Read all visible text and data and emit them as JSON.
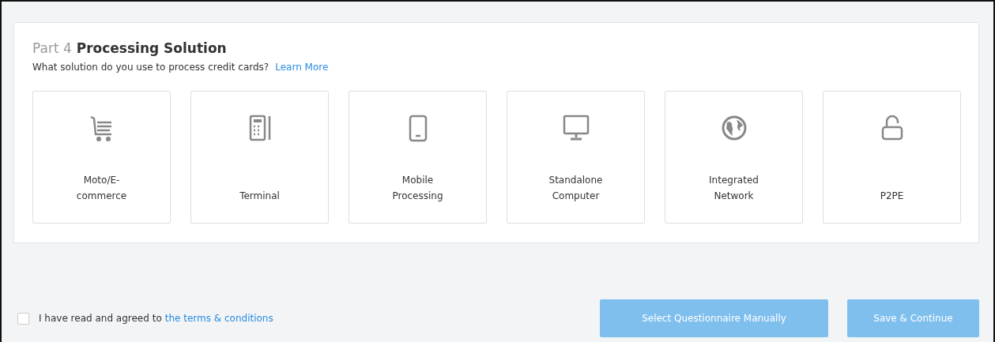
{
  "section": {
    "part": "Part 4",
    "title": "Processing Solution",
    "question": "What solution do you use to process credit cards?",
    "link": "Learn More"
  },
  "options": [
    {
      "kind": "cart",
      "label": "Moto/E-commerce"
    },
    {
      "kind": "terminal",
      "label": "Terminal"
    },
    {
      "kind": "phone",
      "label": "Mobile Processing"
    },
    {
      "kind": "monitor",
      "label": "Standalone Computer"
    },
    {
      "kind": "globe",
      "label": "Integrated Network"
    },
    {
      "kind": "lock",
      "label": "P2PE"
    }
  ],
  "agreement": {
    "checked": false,
    "text": "I have read and agreed to",
    "link": "the terms & conditions"
  },
  "buttons": [
    {
      "label": "Select Questionnaire Manually",
      "disabled": true
    },
    {
      "label": "Save & Continue",
      "disabled": true
    }
  ]
}
